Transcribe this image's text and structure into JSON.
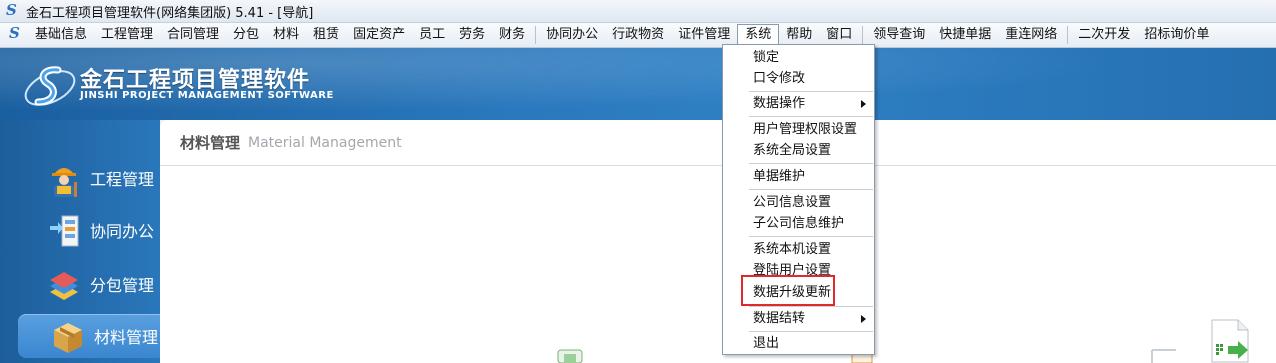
{
  "window": {
    "title": "金石工程项目管理软件(网络集团版) 5.41 - [导航]"
  },
  "menubar": {
    "items": [
      {
        "label": "基础信息"
      },
      {
        "label": "工程管理"
      },
      {
        "label": "合同管理"
      },
      {
        "label": "分包"
      },
      {
        "label": "材料"
      },
      {
        "label": "租赁"
      },
      {
        "label": "固定资产"
      },
      {
        "label": "员工"
      },
      {
        "label": "劳务"
      },
      {
        "label": "财务"
      },
      {
        "label": "协同办公"
      },
      {
        "label": "行政物资"
      },
      {
        "label": "证件管理"
      },
      {
        "label": "系统"
      },
      {
        "label": "帮助"
      },
      {
        "label": "窗口"
      },
      {
        "label": "领导查询"
      },
      {
        "label": "快捷单据"
      },
      {
        "label": "重连网络"
      },
      {
        "label": "二次开发"
      },
      {
        "label": "招标询价单"
      }
    ]
  },
  "header": {
    "title": "金石工程项目管理软件",
    "subtitle": "JINSHI PROJECT MANAGEMENT SOFTWARE"
  },
  "sidebar": {
    "items": [
      {
        "label": "工程管理",
        "icon": "worker-icon"
      },
      {
        "label": "协同办公",
        "icon": "collaboration-icon"
      },
      {
        "label": "分包管理",
        "icon": "subcontract-icon"
      },
      {
        "label": "材料管理",
        "icon": "material-box-icon"
      }
    ]
  },
  "content": {
    "title_cn": "材料管理",
    "title_en": "Material Management"
  },
  "system_menu": {
    "items": [
      {
        "label": "锁定"
      },
      {
        "label": "口令修改"
      },
      {
        "label": "数据操作"
      },
      {
        "label": "用户管理权限设置"
      },
      {
        "label": "系统全局设置"
      },
      {
        "label": "单据维护"
      },
      {
        "label": "公司信息设置"
      },
      {
        "label": "子公司信息维护"
      },
      {
        "label": "系统本机设置"
      },
      {
        "label": "登陆用户设置"
      },
      {
        "label": "数据升级更新"
      },
      {
        "label": "数据结转"
      },
      {
        "label": "退出"
      }
    ]
  },
  "colors": {
    "header_blue": "#2a78bd",
    "highlight_red": "#e02a2a"
  }
}
